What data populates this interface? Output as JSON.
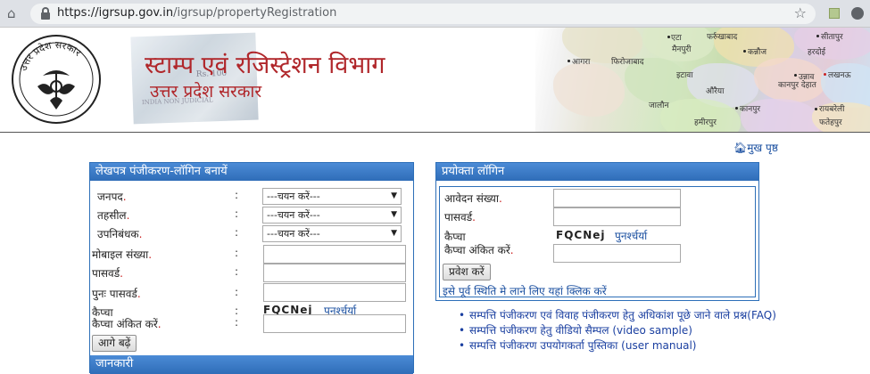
{
  "browser": {
    "url_host": "https://igrsup.gov.in",
    "url_path": "/igrsup/propertyRegistration"
  },
  "header": {
    "title": "स्टाम्प एवं रजिस्ट्रेशन विभाग",
    "subtitle": "उत्तर प्रदेश सरकार",
    "emblem_text": "उत्तर प्रदेश सरकार",
    "map_labels": [
      "एटा",
      "फर्रुखाबाद",
      "मैनपुरी",
      "कन्नौज",
      "फिरोजाबाद",
      "आगरा",
      "इटावा",
      "औरैया",
      "कानपुर",
      "जालौन",
      "हमीरपुर",
      "कानपुर देहात",
      "उन्नाव",
      "लखनऊ",
      "हरदोई",
      "सीतापुर",
      "रायबरेली",
      "फतेहपुर"
    ]
  },
  "nav": {
    "home_label": "मुख पृष्ठ"
  },
  "left_panel": {
    "title": "लेखपत्र पंजीकरण-लॉगिन बनायें",
    "fields": [
      {
        "label": "जनपद",
        "type": "select",
        "value": "---चयन करें---"
      },
      {
        "label": "तहसील",
        "type": "select",
        "value": "---चयन करें---"
      },
      {
        "label": "उपनिबंधक",
        "type": "select",
        "value": "---चयन करें---"
      },
      {
        "label": "मोबाइल संख्या",
        "type": "input",
        "value": ""
      },
      {
        "label": "पासवर्ड",
        "type": "input",
        "value": ""
      },
      {
        "label": "पुनः पासवर्ड",
        "type": "input",
        "value": ""
      },
      {
        "label": "कैप्चा",
        "type": "captcha",
        "value": "FQCNej"
      },
      {
        "label": "कैप्चा अंकित करें",
        "type": "input",
        "value": ""
      }
    ],
    "required_mark": ".",
    "colon": ":",
    "refresh_label": "पुनर्श्चर्या",
    "submit_label": "आगे बढ़ें",
    "info_title": "जानकारी"
  },
  "right_panel": {
    "title": "प्रयोक्ता लॉगिन",
    "application_label": "आवेदन संख्या",
    "password_label": "पासवर्ड",
    "captcha_label": "कैप्चा",
    "captcha_value": "FQCNej",
    "refresh_label": "पुनर्श्चर्या",
    "captcha_input_label": "कैप्चा अंकित करें",
    "login_label": "प्रवेश करें",
    "status_link": "इसे पूर्व स्थिति मे लाने लिए यहां क्लिक करें"
  },
  "links": [
    "सम्पत्ति पंजीकरण एवं विवाह पंजीकरण हेतु अधिकांश पूछे जाने वाले प्रश्न(FAQ)",
    "सम्पत्ति पंजीकरण हेतु वीडियो सैम्पल (video sample)",
    "सम्पत्ति पंजीकरण उपयोगकर्ता पुस्तिका (user manual)"
  ],
  "colors": {
    "panel_header": "#3b7bc8",
    "required": "#cc2222",
    "link": "#1a4fa0",
    "dept_title": "#b0262a"
  }
}
